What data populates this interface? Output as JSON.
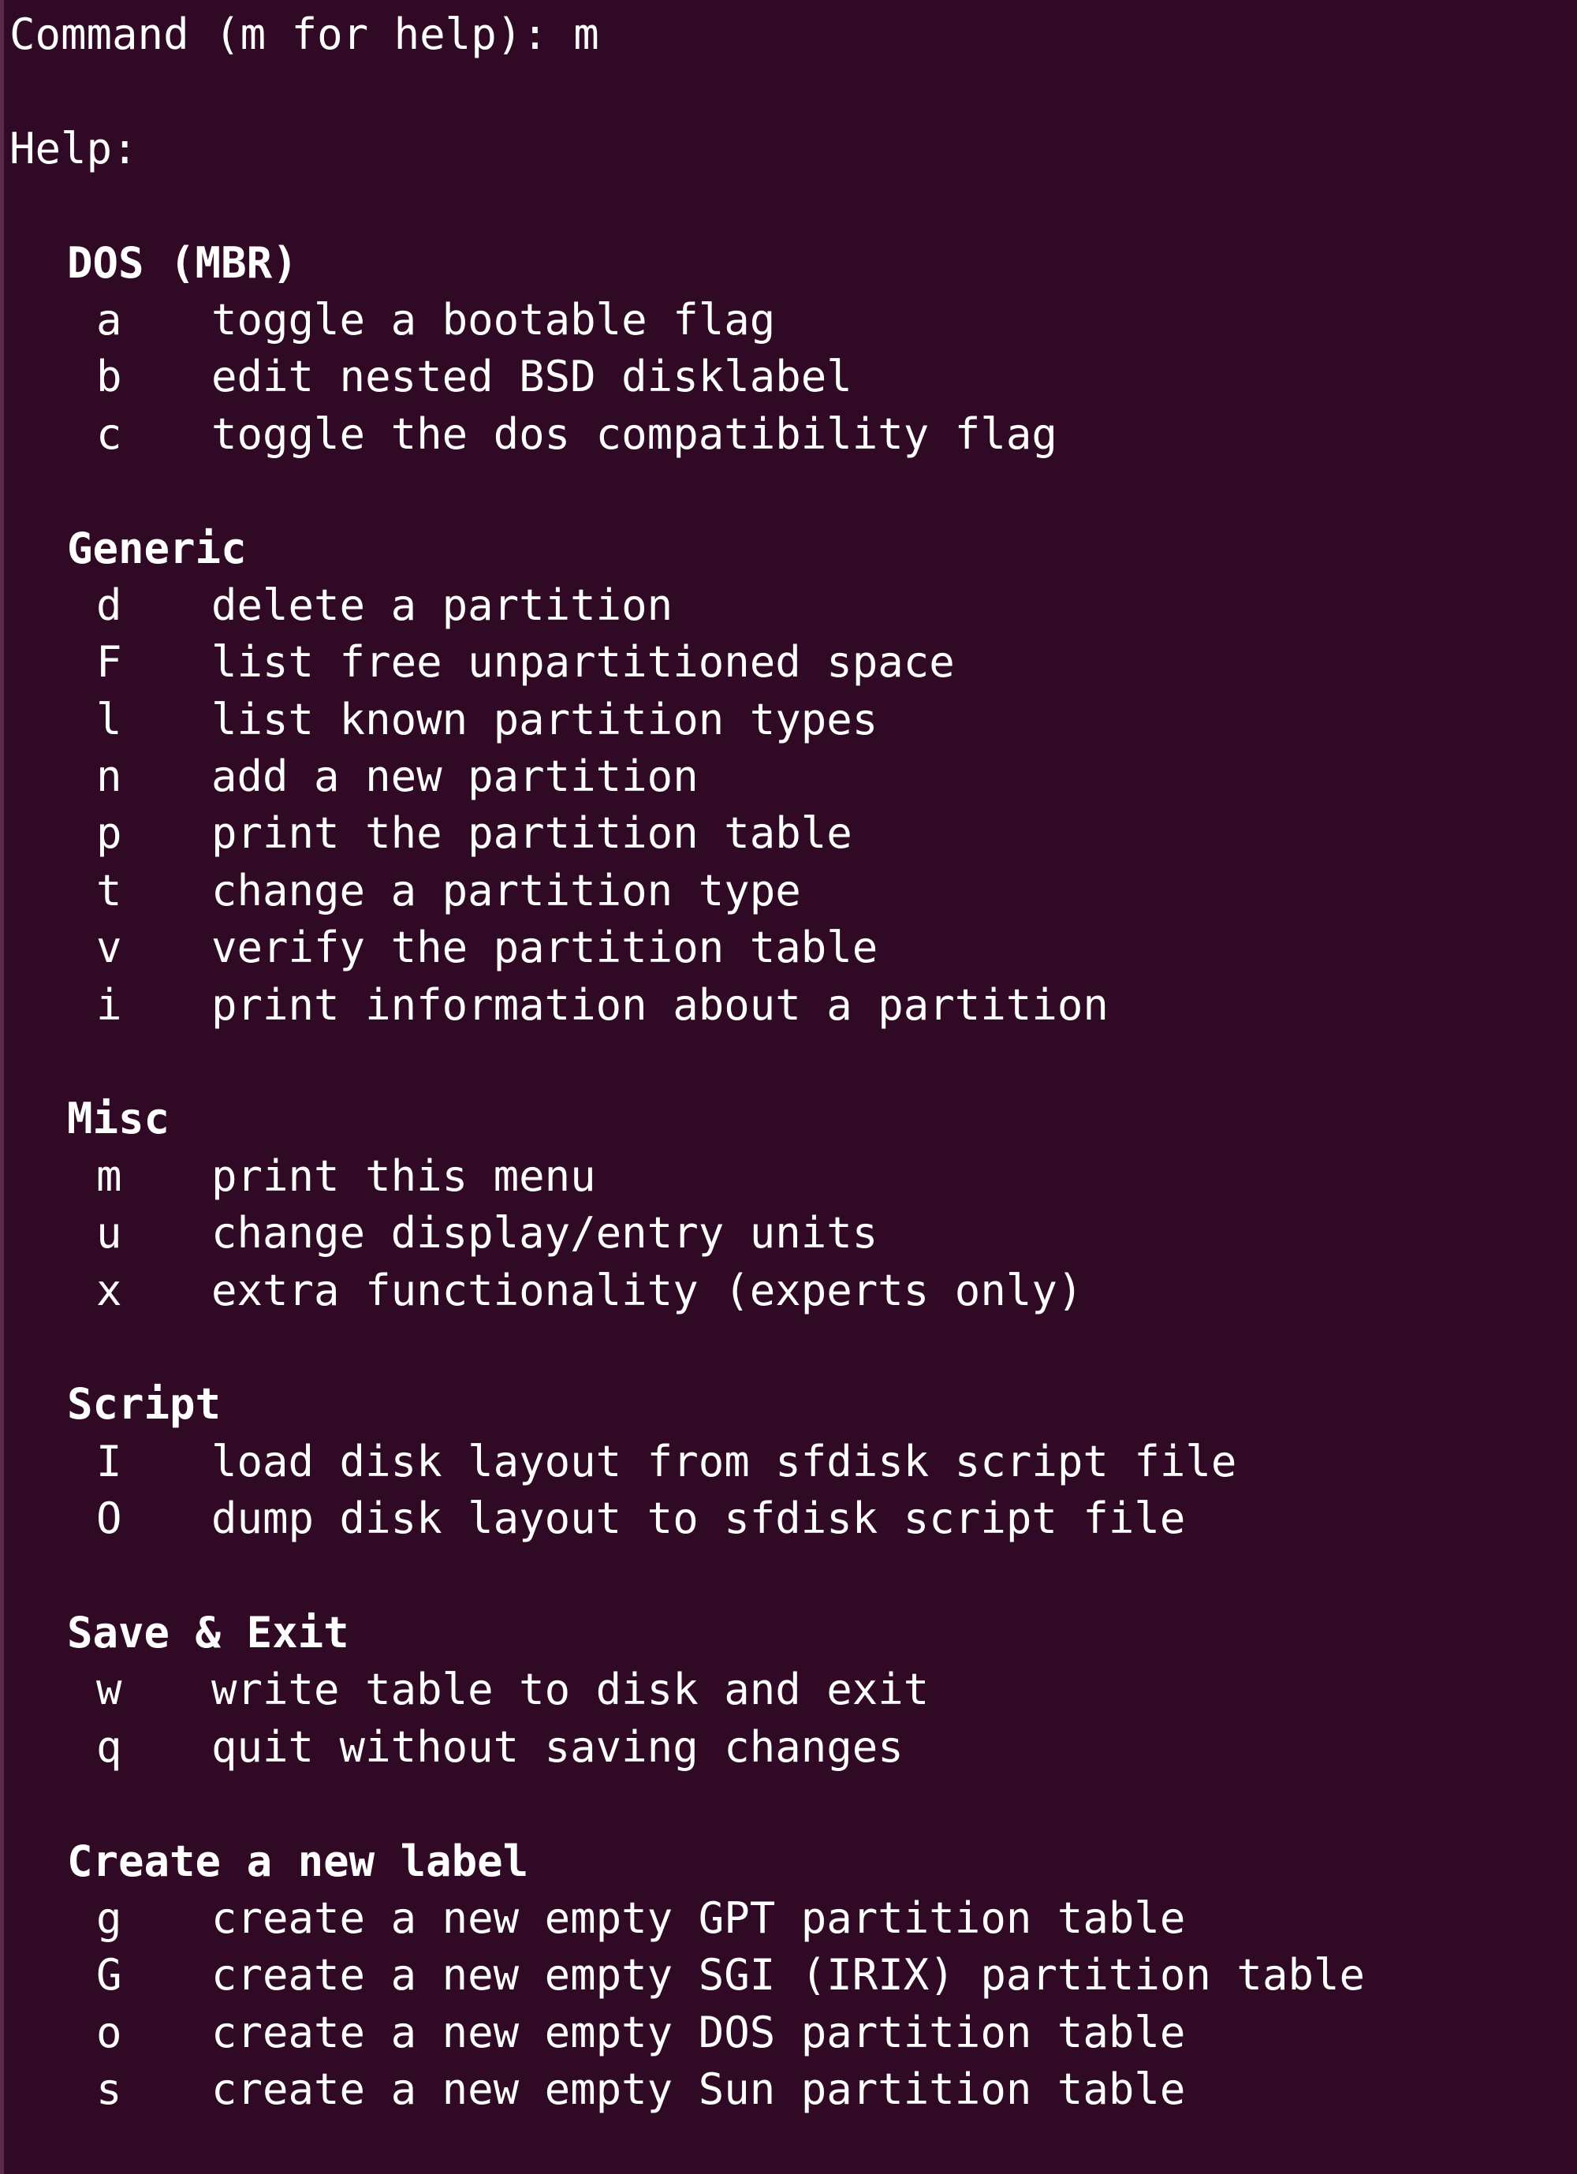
{
  "prompt": {
    "label": "Command (m for help): ",
    "input": "m"
  },
  "help_label": "Help:",
  "sections": [
    {
      "title": "DOS (MBR)",
      "items": [
        {
          "key": "a",
          "desc": "toggle a bootable flag"
        },
        {
          "key": "b",
          "desc": "edit nested BSD disklabel"
        },
        {
          "key": "c",
          "desc": "toggle the dos compatibility flag"
        }
      ]
    },
    {
      "title": "Generic",
      "items": [
        {
          "key": "d",
          "desc": "delete a partition"
        },
        {
          "key": "F",
          "desc": "list free unpartitioned space"
        },
        {
          "key": "l",
          "desc": "list known partition types"
        },
        {
          "key": "n",
          "desc": "add a new partition"
        },
        {
          "key": "p",
          "desc": "print the partition table"
        },
        {
          "key": "t",
          "desc": "change a partition type"
        },
        {
          "key": "v",
          "desc": "verify the partition table"
        },
        {
          "key": "i",
          "desc": "print information about a partition"
        }
      ]
    },
    {
      "title": "Misc",
      "items": [
        {
          "key": "m",
          "desc": "print this menu"
        },
        {
          "key": "u",
          "desc": "change display/entry units"
        },
        {
          "key": "x",
          "desc": "extra functionality (experts only)"
        }
      ]
    },
    {
      "title": "Script",
      "items": [
        {
          "key": "I",
          "desc": "load disk layout from sfdisk script file"
        },
        {
          "key": "O",
          "desc": "dump disk layout to sfdisk script file"
        }
      ]
    },
    {
      "title": "Save & Exit",
      "items": [
        {
          "key": "w",
          "desc": "write table to disk and exit"
        },
        {
          "key": "q",
          "desc": "quit without saving changes"
        }
      ]
    },
    {
      "title": "Create a new label",
      "items": [
        {
          "key": "g",
          "desc": "create a new empty GPT partition table"
        },
        {
          "key": "G",
          "desc": "create a new empty SGI (IRIX) partition table"
        },
        {
          "key": "o",
          "desc": "create a new empty DOS partition table"
        },
        {
          "key": "s",
          "desc": "create a new empty Sun partition table"
        }
      ]
    }
  ],
  "colors": {
    "background": "#300a24",
    "foreground": "#ffffff"
  }
}
